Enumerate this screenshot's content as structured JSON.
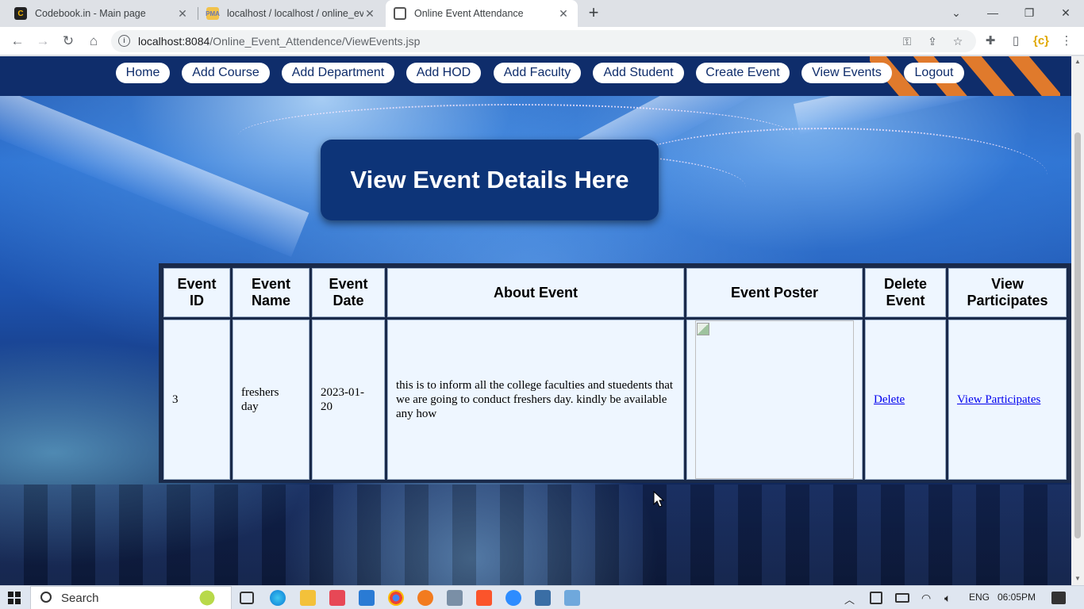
{
  "browser": {
    "tabs": [
      {
        "title": "Codebook.in - Main page",
        "favicon": "codebook-favicon-icon"
      },
      {
        "title": "localhost / localhost / online_eve",
        "favicon": "phpmyadmin-favicon-icon"
      },
      {
        "title": "Online Event Attendance",
        "favicon": "page-favicon-icon",
        "active": true
      }
    ],
    "url_host": "localhost:8084",
    "url_path": "/Online_Event_Attendence/ViewEvents.jsp"
  },
  "nav": {
    "items": [
      "Home",
      "Add Course",
      "Add Department",
      "Add HOD",
      "Add Faculty",
      "Add Student",
      "Create Event",
      "View Events",
      "Logout"
    ],
    "bg_color": "#0f2d6b",
    "accent_color": "#e07a2c"
  },
  "banner": {
    "title": "View Event Details Here",
    "bg_color": "#0d3478"
  },
  "events_table": {
    "headers": [
      [
        "Event",
        "ID"
      ],
      [
        "Event",
        "Name"
      ],
      [
        "Event",
        "Date"
      ],
      [
        "About Event"
      ],
      [
        "Event Poster"
      ],
      [
        "Delete",
        "Event"
      ],
      [
        "View",
        "Participates"
      ]
    ],
    "rows": [
      {
        "id": "3",
        "name": [
          "freshers",
          "day"
        ],
        "date": [
          "2023-01-",
          "20"
        ],
        "about": "this is to inform all the college faculties and stuedents that we are going to conduct freshers day. kindly be available any how",
        "delete_link": "Delete",
        "view_link": "View Participates"
      }
    ]
  },
  "taskbar": {
    "search_label": "Search",
    "language": "ENG",
    "clock": "06:05PM"
  }
}
